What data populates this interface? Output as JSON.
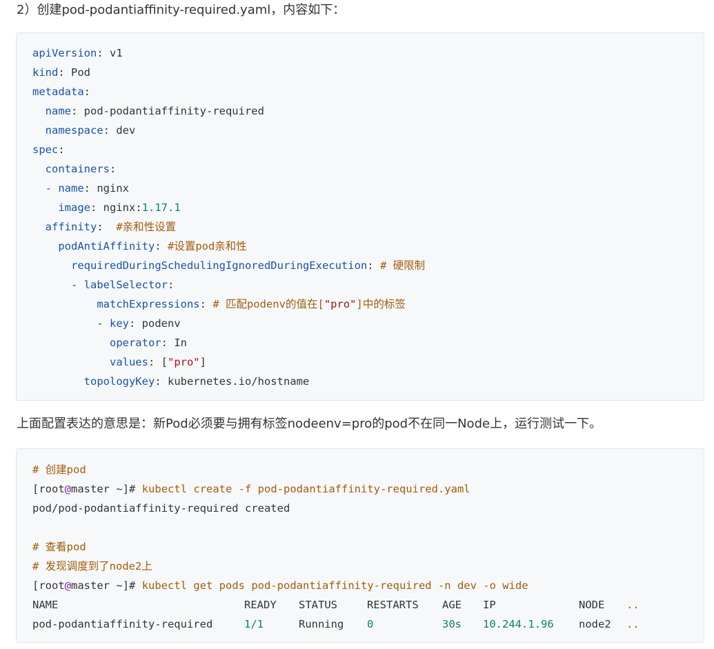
{
  "intro_text": "2）创建pod-podantiaffinity-required.yaml，内容如下：",
  "yaml": {
    "l1_key": "apiVersion",
    "l1_val": "v1",
    "l2_key": "kind",
    "l2_val": "Pod",
    "l3_key": "metadata",
    "l4_key": "name",
    "l4_val": "pod-podantiaffinity-required",
    "l5_key": "namespace",
    "l5_val": "dev",
    "l6_key": "spec",
    "l7_key": "containers",
    "l8_key": "name",
    "l8_val": "nginx",
    "l9_key": "image",
    "l9_val": "nginx:",
    "l9_num": "1.17.1",
    "l10_key": "affinity",
    "l10_comment": "#亲和性设置",
    "l11_key": "podAntiAffinity",
    "l11_comment": "#设置pod亲和性",
    "l12_key": "requiredDuringSchedulingIgnoredDuringExecution",
    "l12_comment": "# 硬限制",
    "l13_key": "labelSelector",
    "l14_key": "matchExpressions",
    "l14_comment_a": "# 匹配podenv的值在[",
    "l14_comment_str": "\"pro\"",
    "l14_comment_b": "]中的标签",
    "l15_key": "key",
    "l15_val": "podenv",
    "l16_key": "operator",
    "l16_val": "In",
    "l17_key": "values",
    "l17_str": "\"pro\"",
    "l18_key": "topologyKey",
    "l18_val": "kubernetes.io/hostname"
  },
  "middle_text": "上面配置表达的意思是：新Pod必须要与拥有标签nodeenv=pro的pod不在同一Node上，运行测试一下。",
  "shell": {
    "comment1": "# 创建pod",
    "user": "root",
    "at": "@",
    "host": "master",
    "path": " ~",
    "prompt_end": "]#",
    "cmd1": "kubectl create -f pod-podantiaffinity-required.yaml",
    "out1": "pod/pod-podantiaffinity-required created",
    "comment2": "# 查看pod",
    "comment3": "# 发现调度到了node2上",
    "cmd2": "kubectl get pods pod-podantiaffinity-required -n dev -o wide",
    "table_headers": [
      "NAME",
      "READY",
      "STATUS",
      "RESTARTS",
      "AGE",
      "IP",
      "NODE",
      ".."
    ],
    "table_row": [
      "pod-podantiaffinity-required",
      "1/1",
      "Running",
      "0",
      "30s",
      "10.244.1.96",
      "node2",
      ".."
    ]
  }
}
